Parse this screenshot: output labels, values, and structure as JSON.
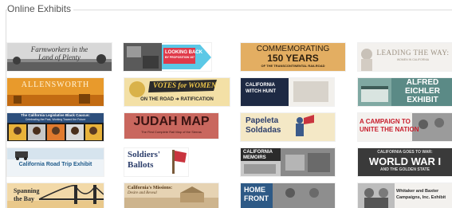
{
  "section": {
    "title": "Online Exhibits"
  },
  "exhibits": [
    {
      "line1": "Farmworkers in the",
      "line2": "Land of Plenty"
    },
    {
      "line1": "LOOKING BACK",
      "line2": "BY PROPOSITION 187"
    },
    {
      "line1": "COMMEMORATING",
      "line2": "150 YEARS",
      "line3": "OF THE TRANSCONTINENTAL RAILROAD"
    },
    {
      "line1": "LEADING THE WAY:",
      "line2": "WOMEN IN CALIFORNIA"
    },
    {
      "line1": "ALLENSWORTH"
    },
    {
      "line1": "VOTES for WOMEN",
      "line2": "ON THE ROAD ➜ RATIFICATION"
    },
    {
      "line1": "CALIFORNIA",
      "line2": "WITCH HUNT"
    },
    {
      "line1": "ALFRED",
      "line2": "EICHLER",
      "line3": "EXHIBIT"
    },
    {
      "line1": "The California Legislative Black Caucus:",
      "line2": "Celebrating the Past, Working Toward the Future"
    },
    {
      "line1": "JUDAH MAP",
      "line2": "The First Complete Rail Map of the Sierras"
    },
    {
      "line1": "Papeleta",
      "line2": "Soldadas"
    },
    {
      "line1": "A CAMPAIGN TO",
      "line2": "UNITE THE NATION"
    },
    {
      "line1": "California Road Trip Exhibit"
    },
    {
      "line1": "Soldiers'",
      "line2": "Ballots"
    },
    {
      "line1": "CALIFORNIA",
      "line2": "MEMOIRS"
    },
    {
      "line1": "CALIFORNIA GOES TO WAR:",
      "line2": "WORLD WAR I",
      "line3": "AND THE GOLDEN STATE"
    },
    {
      "line1": "Spanning",
      "line2": "the Bay"
    },
    {
      "line1": "California's Missions:",
      "line2": "Desire and Reveal"
    },
    {
      "line1": "HOME",
      "line2": "FRONT"
    },
    {
      "line1": "Whitaker and Baxter",
      "line2": "Campaigns, Inc. Exhibit"
    }
  ]
}
